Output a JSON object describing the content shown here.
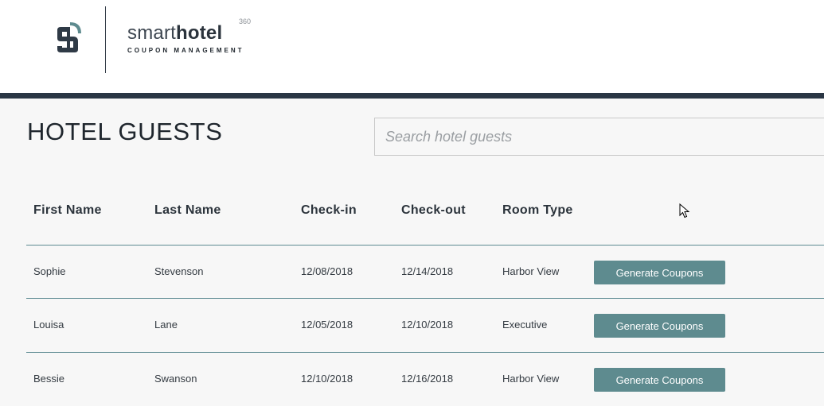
{
  "header": {
    "brand_light": "smart",
    "brand_bold": "hotel",
    "brand_sup": "360",
    "brand_sub": "COUPON MANAGEMENT",
    "logo_icon": "smarthotel-logo-icon"
  },
  "colors": {
    "accent": "#5e8b8f",
    "topbar": "#2a3644",
    "background": "#f7f7f7"
  },
  "main": {
    "title": "HOTEL GUESTS",
    "search_placeholder": "Search hotel guests",
    "columns": [
      "First Name",
      "Last Name",
      "Check-in",
      "Check-out",
      "Room Type"
    ],
    "rows": [
      {
        "first": "Sophie",
        "last": "Stevenson",
        "checkin": "12/08/2018",
        "checkout": "12/14/2018",
        "room": "Harbor View",
        "action": "Generate Coupons"
      },
      {
        "first": "Louisa",
        "last": "Lane",
        "checkin": "12/05/2018",
        "checkout": "12/10/2018",
        "room": "Executive",
        "action": "Generate Coupons"
      },
      {
        "first": "Bessie",
        "last": "Swanson",
        "checkin": "12/10/2018",
        "checkout": "12/16/2018",
        "room": "Harbor View",
        "action": "Generate Coupons"
      }
    ]
  }
}
